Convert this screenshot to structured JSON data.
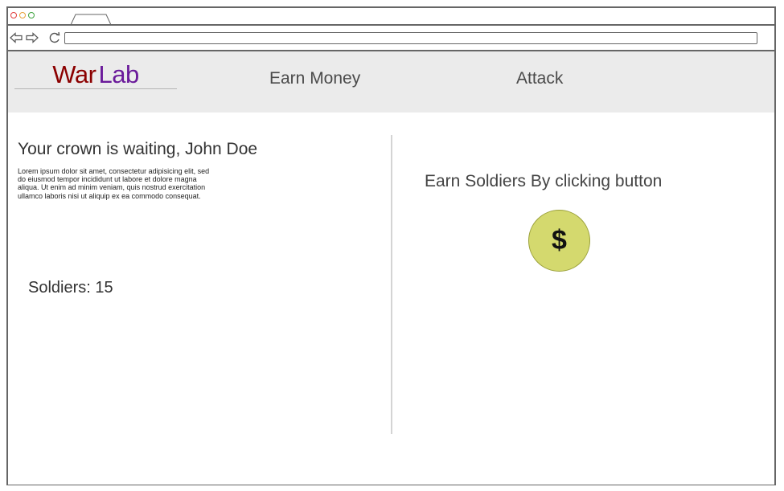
{
  "browser": {
    "url": ""
  },
  "header": {
    "logo_part1": "War",
    "logo_part2": "Lab",
    "nav": [
      {
        "label": "Earn Money"
      },
      {
        "label": "Attack"
      }
    ]
  },
  "main": {
    "welcome": "Your crown is waiting, John Doe",
    "description": "Lorem ipsum dolor sit amet, consectetur adipisicing elit, sed do eiusmod tempor incididunt ut labore et dolore magna aliqua. Ut enim ad minim veniam, quis nostrud exercitation ullamco laboris nisi ut aliquip ex ea commodo consequat.",
    "soldiers_label": "Soldiers: 15"
  },
  "earn_panel": {
    "caption": "Earn Soldiers By clicking button",
    "button_symbol": "$"
  },
  "colors": {
    "logo_war": "#8b0000",
    "logo_lab": "#6a1a9a",
    "header_bg": "#ebebeb",
    "button_fill": "#d4d96e"
  }
}
